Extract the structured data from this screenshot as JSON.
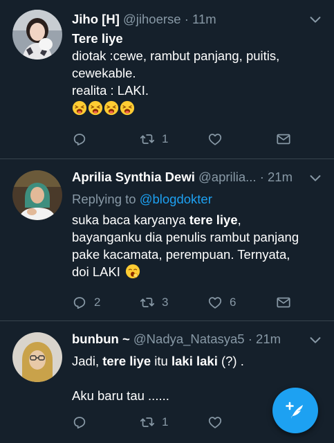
{
  "tweets": [
    {
      "name": "Jiho [H]",
      "handle": "@jihoerse",
      "dot": "·",
      "time": "11m",
      "line1": "Tere liye",
      "line2": "diotak :cewe, rambut panjang, puitis,",
      "line3": "cewekable.",
      "line4": "realita : LAKI.",
      "emojis": "😫😫😫😫",
      "reply_count": "",
      "retweet_count": "1",
      "like_count": ""
    },
    {
      "name": "Aprilia Synthia Dewi",
      "handle": "@aprilia...",
      "dot": "·",
      "time": "21m",
      "replying_prefix": "Replying to ",
      "replying_mention": "@blogdokter",
      "line1a": "suka baca karyanya ",
      "line1b": "tere liye",
      "line1c": ",",
      "line2": "bayanganku dia penulis rambut panjang",
      "line3": "pake kacamata, perempuan. Ternyata,",
      "line4": "doi LAKI",
      "emoji": "😮",
      "reply_count": "2",
      "retweet_count": "3",
      "like_count": "6"
    },
    {
      "name": "bunbun ~",
      "handle": "@Nadya_Natasya5",
      "dot": "·",
      "time": "21m",
      "line1a": "Jadi, ",
      "line1b": "tere liye",
      "line1c": " itu ",
      "line1d": "laki laki",
      "line1e": " (?) .",
      "line2": "Aku baru tau ......",
      "reply_count": "",
      "retweet_count": "1",
      "like_count": ""
    }
  ],
  "icons": {
    "reply": "reply-icon",
    "retweet": "retweet-icon",
    "like": "heart-icon",
    "dm": "mail-icon",
    "compose": "compose-feather-icon"
  },
  "colors": {
    "background": "#15202b",
    "accent": "#1da1f2",
    "muted": "#8899a6",
    "divider": "#38444d"
  }
}
